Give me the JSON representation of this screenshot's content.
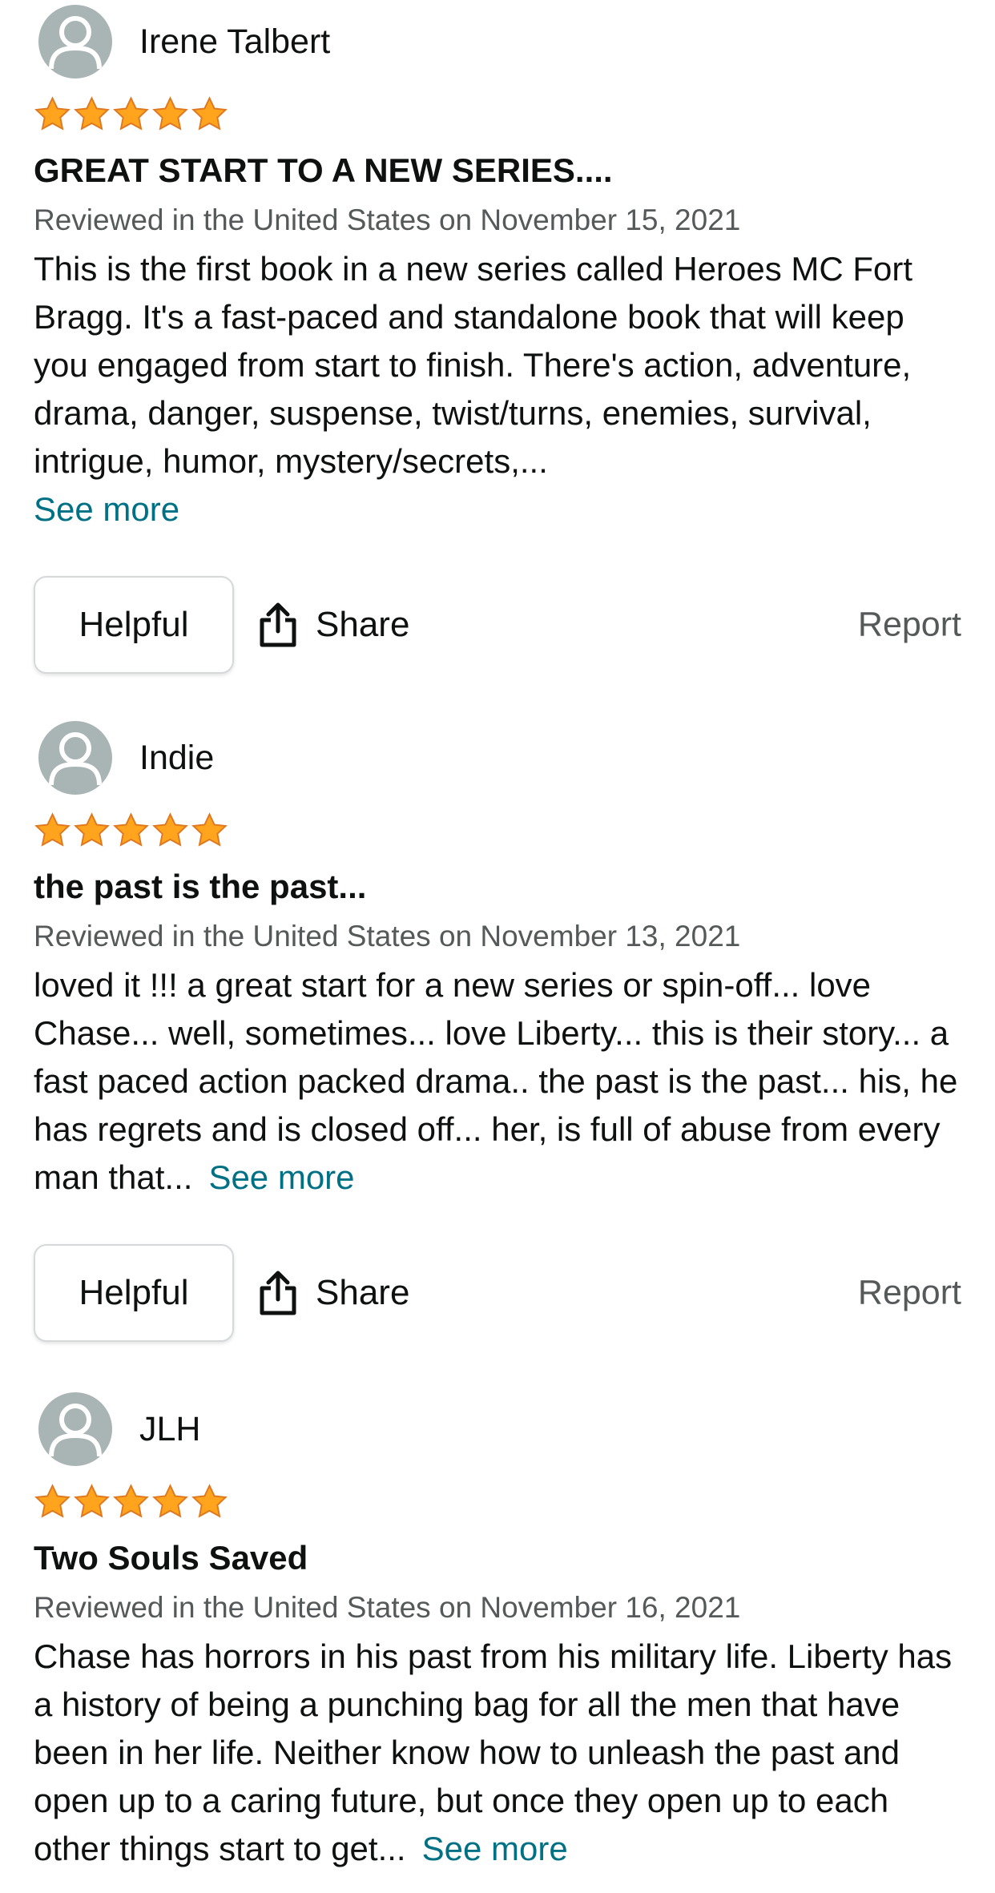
{
  "reviews": [
    {
      "author": "Irene Talbert",
      "rating": 5,
      "title": "GREAT START TO A NEW SERIES....",
      "date": "Reviewed in the United States on November 15, 2021",
      "body": "This is the first book in a new series called Heroes MC Fort Bragg. It's a fast-paced and standalone book that will keep you engaged from start to finish. There's action, adventure, drama, danger, suspense, twist/turns, enemies, survival, intrigue, humor, mystery/secrets,...",
      "see_more": "See more",
      "helpful": "Helpful",
      "share": "Share",
      "report": "Report"
    },
    {
      "author": "Indie",
      "rating": 5,
      "title": "the past is the past...",
      "date": "Reviewed in the United States on November 13, 2021",
      "body": "loved it !!! a great start for a new series or spin-off... love Chase... well, sometimes... love Liberty... this is their story... a fast paced action packed drama.. the past is the past... his, he has regrets and is closed off... her, is full of abuse from every man that...",
      "see_more": "See more",
      "helpful": "Helpful",
      "share": "Share",
      "report": "Report"
    },
    {
      "author": "JLH",
      "rating": 5,
      "title": "Two Souls Saved",
      "date": "Reviewed in the United States on November 16, 2021",
      "body": "Chase has horrors in his past from his military life. Liberty has a history of being a punching bag for all the men that have been in her life. Neither know how to unleash the past and open up to a caring future, but once they open up to each other things start to get...",
      "see_more": "See more"
    }
  ],
  "icons": {
    "avatar": "user-avatar-icon",
    "star": "star-icon",
    "share": "share-icon"
  },
  "colors": {
    "star_fill": "#FFA41C",
    "star_stroke": "#DE7921",
    "link": "#007185",
    "secondary_text": "#565959",
    "avatar_bg": "#A9B4B4"
  }
}
